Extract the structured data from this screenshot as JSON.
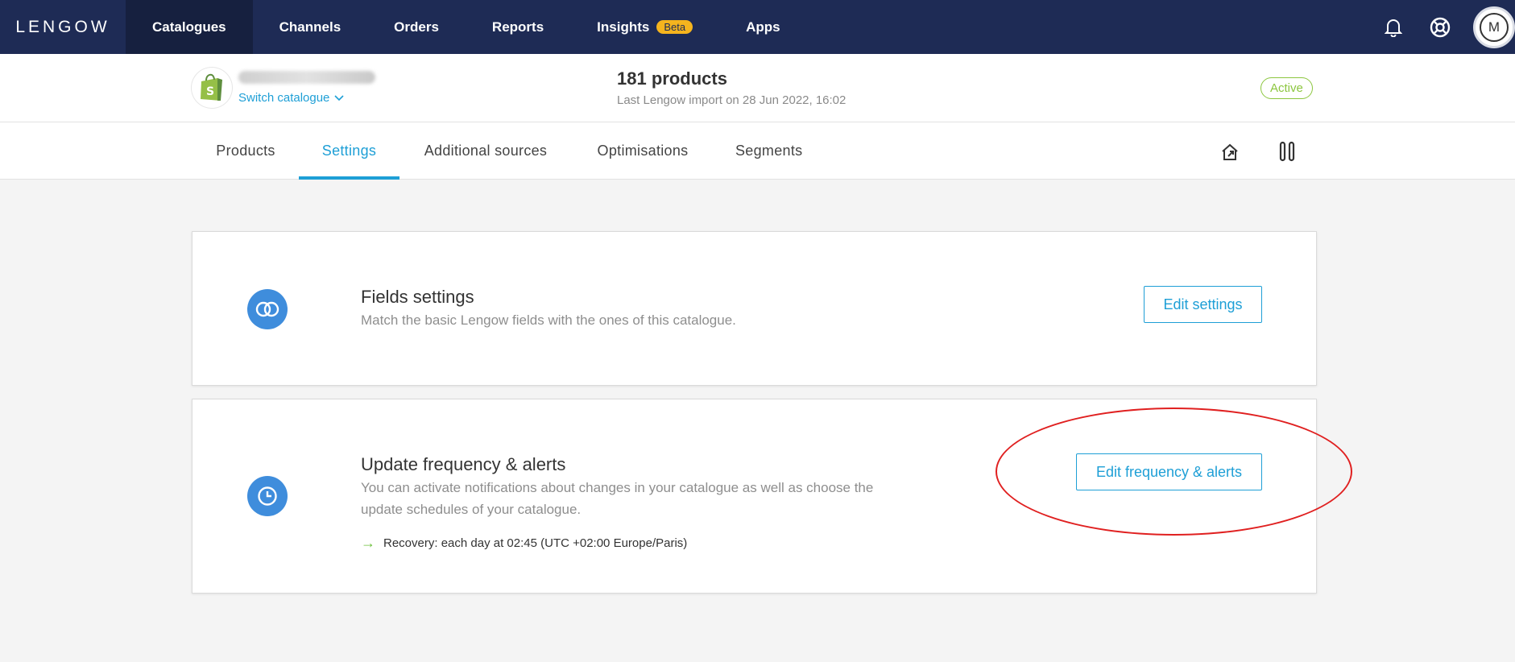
{
  "app": {
    "logo": "LENGOW"
  },
  "nav": {
    "items": [
      {
        "label": "Catalogues",
        "active": true
      },
      {
        "label": "Channels"
      },
      {
        "label": "Orders"
      },
      {
        "label": "Reports"
      },
      {
        "label": "Insights",
        "badge": "Beta"
      },
      {
        "label": "Apps"
      }
    ],
    "right_icons": [
      "bell-icon",
      "help-lifebuoy-icon",
      "avatar"
    ],
    "avatar_initial": "M"
  },
  "catalogue": {
    "switch_label": "Switch catalogue",
    "products_count": "181 products",
    "last_import": "Last Lengow import on 28 Jun 2022, 16:02",
    "status": "Active"
  },
  "tabs": [
    {
      "label": "Products"
    },
    {
      "label": "Settings",
      "active": true
    },
    {
      "label": "Additional sources"
    },
    {
      "label": "Optimisations"
    },
    {
      "label": "Segments"
    }
  ],
  "tab_actions": [
    "export-icon",
    "pause-icon"
  ],
  "cards": {
    "fields": {
      "title": "Fields settings",
      "description": "Match the basic Lengow fields with the ones of this catalogue.",
      "button": "Edit settings"
    },
    "frequency": {
      "title": "Update frequency & alerts",
      "description": "You can activate notifications about changes in your catalogue as well as choose the update schedules of your catalogue.",
      "recovery": "Recovery: each day at 02:45 (UTC +02:00 Europe/Paris)",
      "button": "Edit frequency & alerts"
    }
  },
  "colors": {
    "nav_bg": "#1e2b55",
    "accent": "#1e9fd6",
    "badge": "#f5b41e",
    "active_status": "#8cc63f",
    "annotation": "#e02020"
  }
}
